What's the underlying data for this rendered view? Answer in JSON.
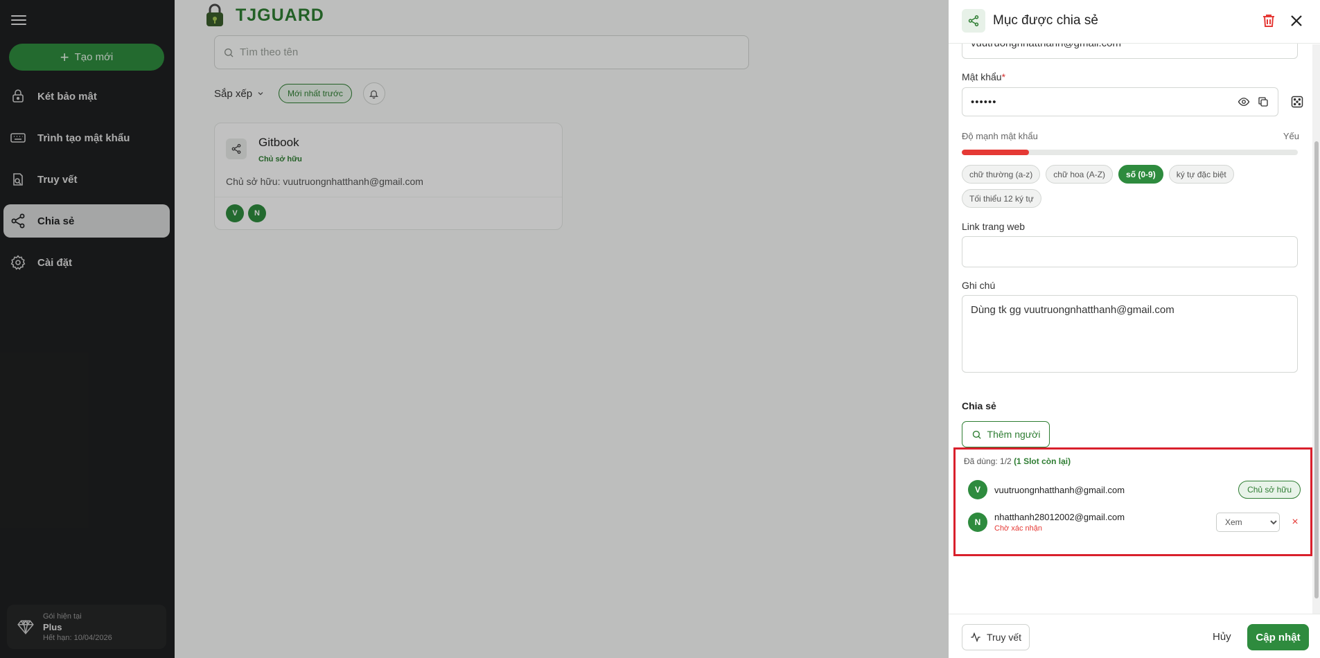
{
  "sidebar": {
    "new_label": "Tạo mới",
    "items": [
      {
        "label": "Két bảo mật",
        "icon": "lock-icon"
      },
      {
        "label": "Trình tạo mật khẩu",
        "icon": "keyboard-icon"
      },
      {
        "label": "Truy vết",
        "icon": "history-icon"
      },
      {
        "label": "Chia sẻ",
        "icon": "share-icon",
        "active": true
      },
      {
        "label": "Cài đặt",
        "icon": "gear-icon"
      }
    ],
    "plan": {
      "title": "Gói hiện tại",
      "name": "Plus",
      "expiry": "Hết hạn: 10/04/2026"
    }
  },
  "main": {
    "brand": "TJGUARD",
    "search_placeholder": "Tìm theo tên",
    "sort_label": "Sắp xếp",
    "sort_value": "Mới nhất trước",
    "card": {
      "title": "Gitbook",
      "role": "Chủ sở hữu",
      "owner": "Chủ sở hữu: vuutruongnhatthanh@gmail.com",
      "avatars": [
        "V",
        "N"
      ]
    }
  },
  "panel": {
    "title": "Mục được chia sẻ",
    "username_value": "vuutruongnhatthanh@gmail.com",
    "password_label": "Mật khẩu",
    "password_value": "••••••",
    "strength_label": "Độ mạnh mật khẩu",
    "strength_value": "Yếu",
    "strength_level": 0.2,
    "requirements": [
      {
        "label": "chữ thường (a-z)",
        "met": false
      },
      {
        "label": "chữ hoa (A-Z)",
        "met": false
      },
      {
        "label": "số (0-9)",
        "met": true
      },
      {
        "label": "ký tự đặc biệt",
        "met": false
      },
      {
        "label": "Tối thiểu 12 ký tự",
        "met": false
      }
    ],
    "website_label": "Link trang web",
    "website_value": "",
    "note_label": "Ghi chú",
    "note_value": "Dùng tk gg vuutruongnhatthanh@gmail.com",
    "share_title": "Chia sẻ",
    "add_person_label": "Thêm người",
    "usage_text": "Đã dùng: 1/2",
    "usage_slot": "(1 Slot còn lại)",
    "members": [
      {
        "initial": "V",
        "email": "vuutruongnhatthanh@gmail.com",
        "role": "Chủ sở hữu"
      },
      {
        "initial": "N",
        "email": "nhatthanh28012002@gmail.com",
        "status": "Chờ xác nhận",
        "permission": "Xem",
        "remove": "×"
      }
    ],
    "footer": {
      "trace_label": "Truy vết",
      "cancel_label": "Hủy",
      "update_label": "Cập nhật"
    }
  },
  "colors": {
    "accent": "#2e8b3e",
    "danger": "#e53935",
    "highlight": "#d9202c"
  }
}
